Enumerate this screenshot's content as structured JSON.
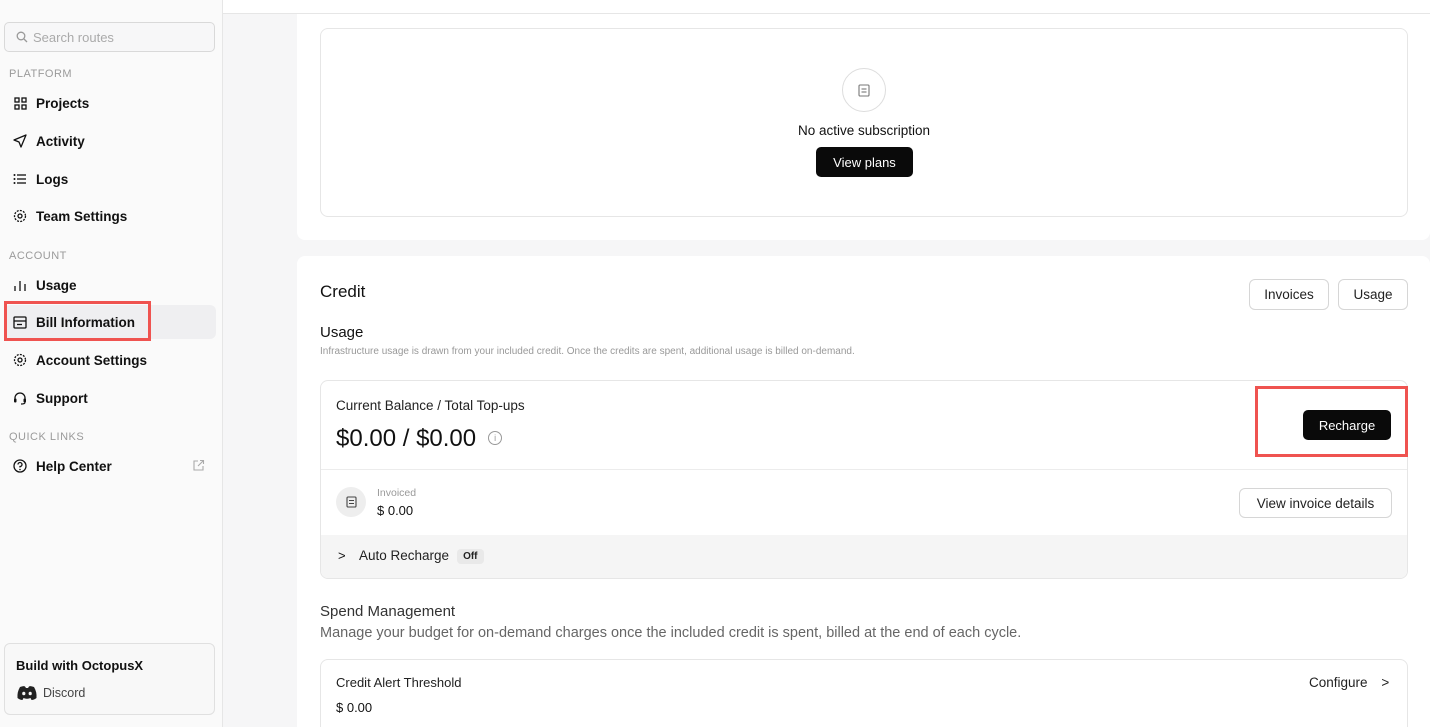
{
  "sidebar": {
    "search_placeholder": "Search routes",
    "platform_label": "PLATFORM",
    "account_label": "ACCOUNT",
    "quick_links_label": "QUICK LINKS",
    "items": {
      "projects": "Projects",
      "activity": "Activity",
      "logs": "Logs",
      "team_settings": "Team Settings",
      "usage": "Usage",
      "bill_information": "Bill Information",
      "account_settings": "Account Settings",
      "support": "Support",
      "help_center": "Help Center"
    },
    "build_card": {
      "title": "Build with OctopusX",
      "discord": "Discord"
    }
  },
  "subscription": {
    "empty_text": "No active subscription",
    "view_plans": "View plans"
  },
  "credit": {
    "title": "Credit",
    "invoices_button": "Invoices",
    "usage_button": "Usage",
    "usage_heading": "Usage",
    "usage_desc": "Infrastructure usage is drawn from your included credit. Once the credits are spent, additional usage is billed on-demand.",
    "balance_label": "Current Balance / Total Top-ups",
    "balance_value": "$0.00 / $0.00",
    "info_glyph": "i",
    "recharge_button": "Recharge",
    "invoiced_label": "Invoiced",
    "invoiced_value": "$ 0.00",
    "view_invoice_details": "View invoice details",
    "auto_recharge_label": "Auto Recharge",
    "auto_recharge_status": "Off",
    "chevron": ">"
  },
  "spend": {
    "title": "Spend Management",
    "desc": "Manage your budget for on-demand charges once the included credit is spent, billed at the end of each cycle.",
    "alert_label": "Credit Alert Threshold",
    "alert_value": "$ 0.00",
    "configure": "Configure",
    "configure_chevron": ">"
  },
  "colors": {
    "highlight": "#ef5350",
    "dark_button": "#0a0a0a"
  }
}
